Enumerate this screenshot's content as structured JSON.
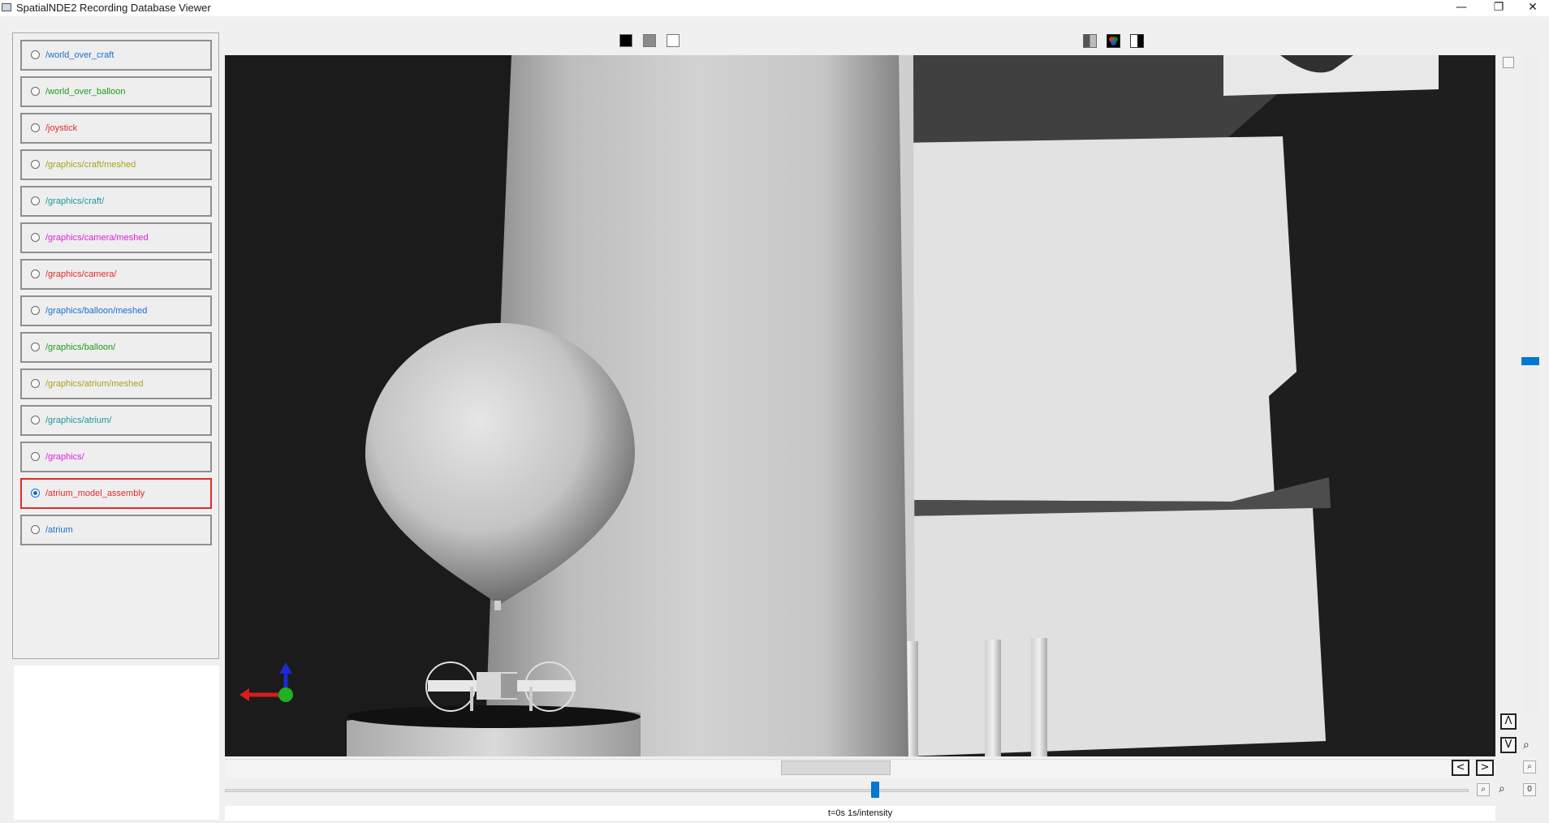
{
  "window": {
    "title": "SpatialNDE2 Recording Database Viewer",
    "min_glyph": "—",
    "max_glyph": "❐",
    "close_glyph": "✕"
  },
  "channels": [
    {
      "label": "/world_over_craft",
      "color": "#1a6fd1",
      "selected": false
    },
    {
      "label": "/world_over_balloon",
      "color": "#1f9a1f",
      "selected": false
    },
    {
      "label": "/joystick",
      "color": "#e32a2a",
      "selected": false
    },
    {
      "label": "/graphics/craft/meshed",
      "color": "#a8a31a",
      "selected": false
    },
    {
      "label": "/graphics/craft/",
      "color": "#1a9a9a",
      "selected": false
    },
    {
      "label": "/graphics/camera/meshed",
      "color": "#e020d8",
      "selected": false
    },
    {
      "label": "/graphics/camera/",
      "color": "#e32a2a",
      "selected": false
    },
    {
      "label": "/graphics/balloon/meshed",
      "color": "#1a6fd1",
      "selected": false
    },
    {
      "label": "/graphics/balloon/",
      "color": "#1f9a1f",
      "selected": false
    },
    {
      "label": "/graphics/atrium/meshed",
      "color": "#a8a31a",
      "selected": false
    },
    {
      "label": "/graphics/atrium/",
      "color": "#1a9a9a",
      "selected": false
    },
    {
      "label": "/graphics/",
      "color": "#e020d8",
      "selected": false
    },
    {
      "label": "/atrium_model_assembly",
      "color": "#e32a2a",
      "selected": true
    },
    {
      "label": "/atrium",
      "color": "#1a6fd1",
      "selected": false
    }
  ],
  "nav": {
    "up_glyph": "Λ",
    "down_glyph": "V",
    "prev_glyph": "<",
    "next_glyph": ">",
    "zoom_glyph": "⌕",
    "zero_label": "0"
  },
  "status": {
    "text": "t=0s 1s/intensity"
  },
  "colors": {
    "selected_border": "#e32a2a",
    "accent": "#0078d4",
    "viewport_bg": "#1b1b1b"
  }
}
